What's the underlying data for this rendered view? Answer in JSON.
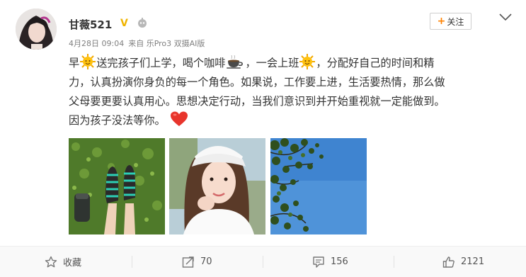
{
  "user": {
    "name": "甘薇521",
    "verified_badge": "V"
  },
  "meta": {
    "date": "4月28日 09:04",
    "source": "来自 乐Pro3 双摄AI版"
  },
  "follow_button": {
    "label": "关注",
    "plus": "+"
  },
  "post": {
    "line1_a": "早",
    "line1_b": "送完孩子们上学，喝个咖啡",
    "line1_c": "，一会上班",
    "line1_d": "，分配好自己的时间和精",
    "line2": "力，认真扮演你身负的每一个角色。如果说，工作要上进，生活要热情，那么做",
    "line3": "父母要更要认真用心。思想决定行动，当我们意识到并开始重视就一定能做到。",
    "line4": "因为孩子没法等你。"
  },
  "photos": [
    {
      "icon": "shoes-on-grass-photo"
    },
    {
      "icon": "woman-selfie-photo"
    },
    {
      "icon": "tree-sky-photo"
    }
  ],
  "actions": {
    "favorite_label": "收藏",
    "repost_count": "70",
    "comment_count": "156",
    "like_count": "2121"
  },
  "colors": {
    "accent": "#ff8200",
    "verified": "#f0b400",
    "meta_text": "#808080"
  }
}
